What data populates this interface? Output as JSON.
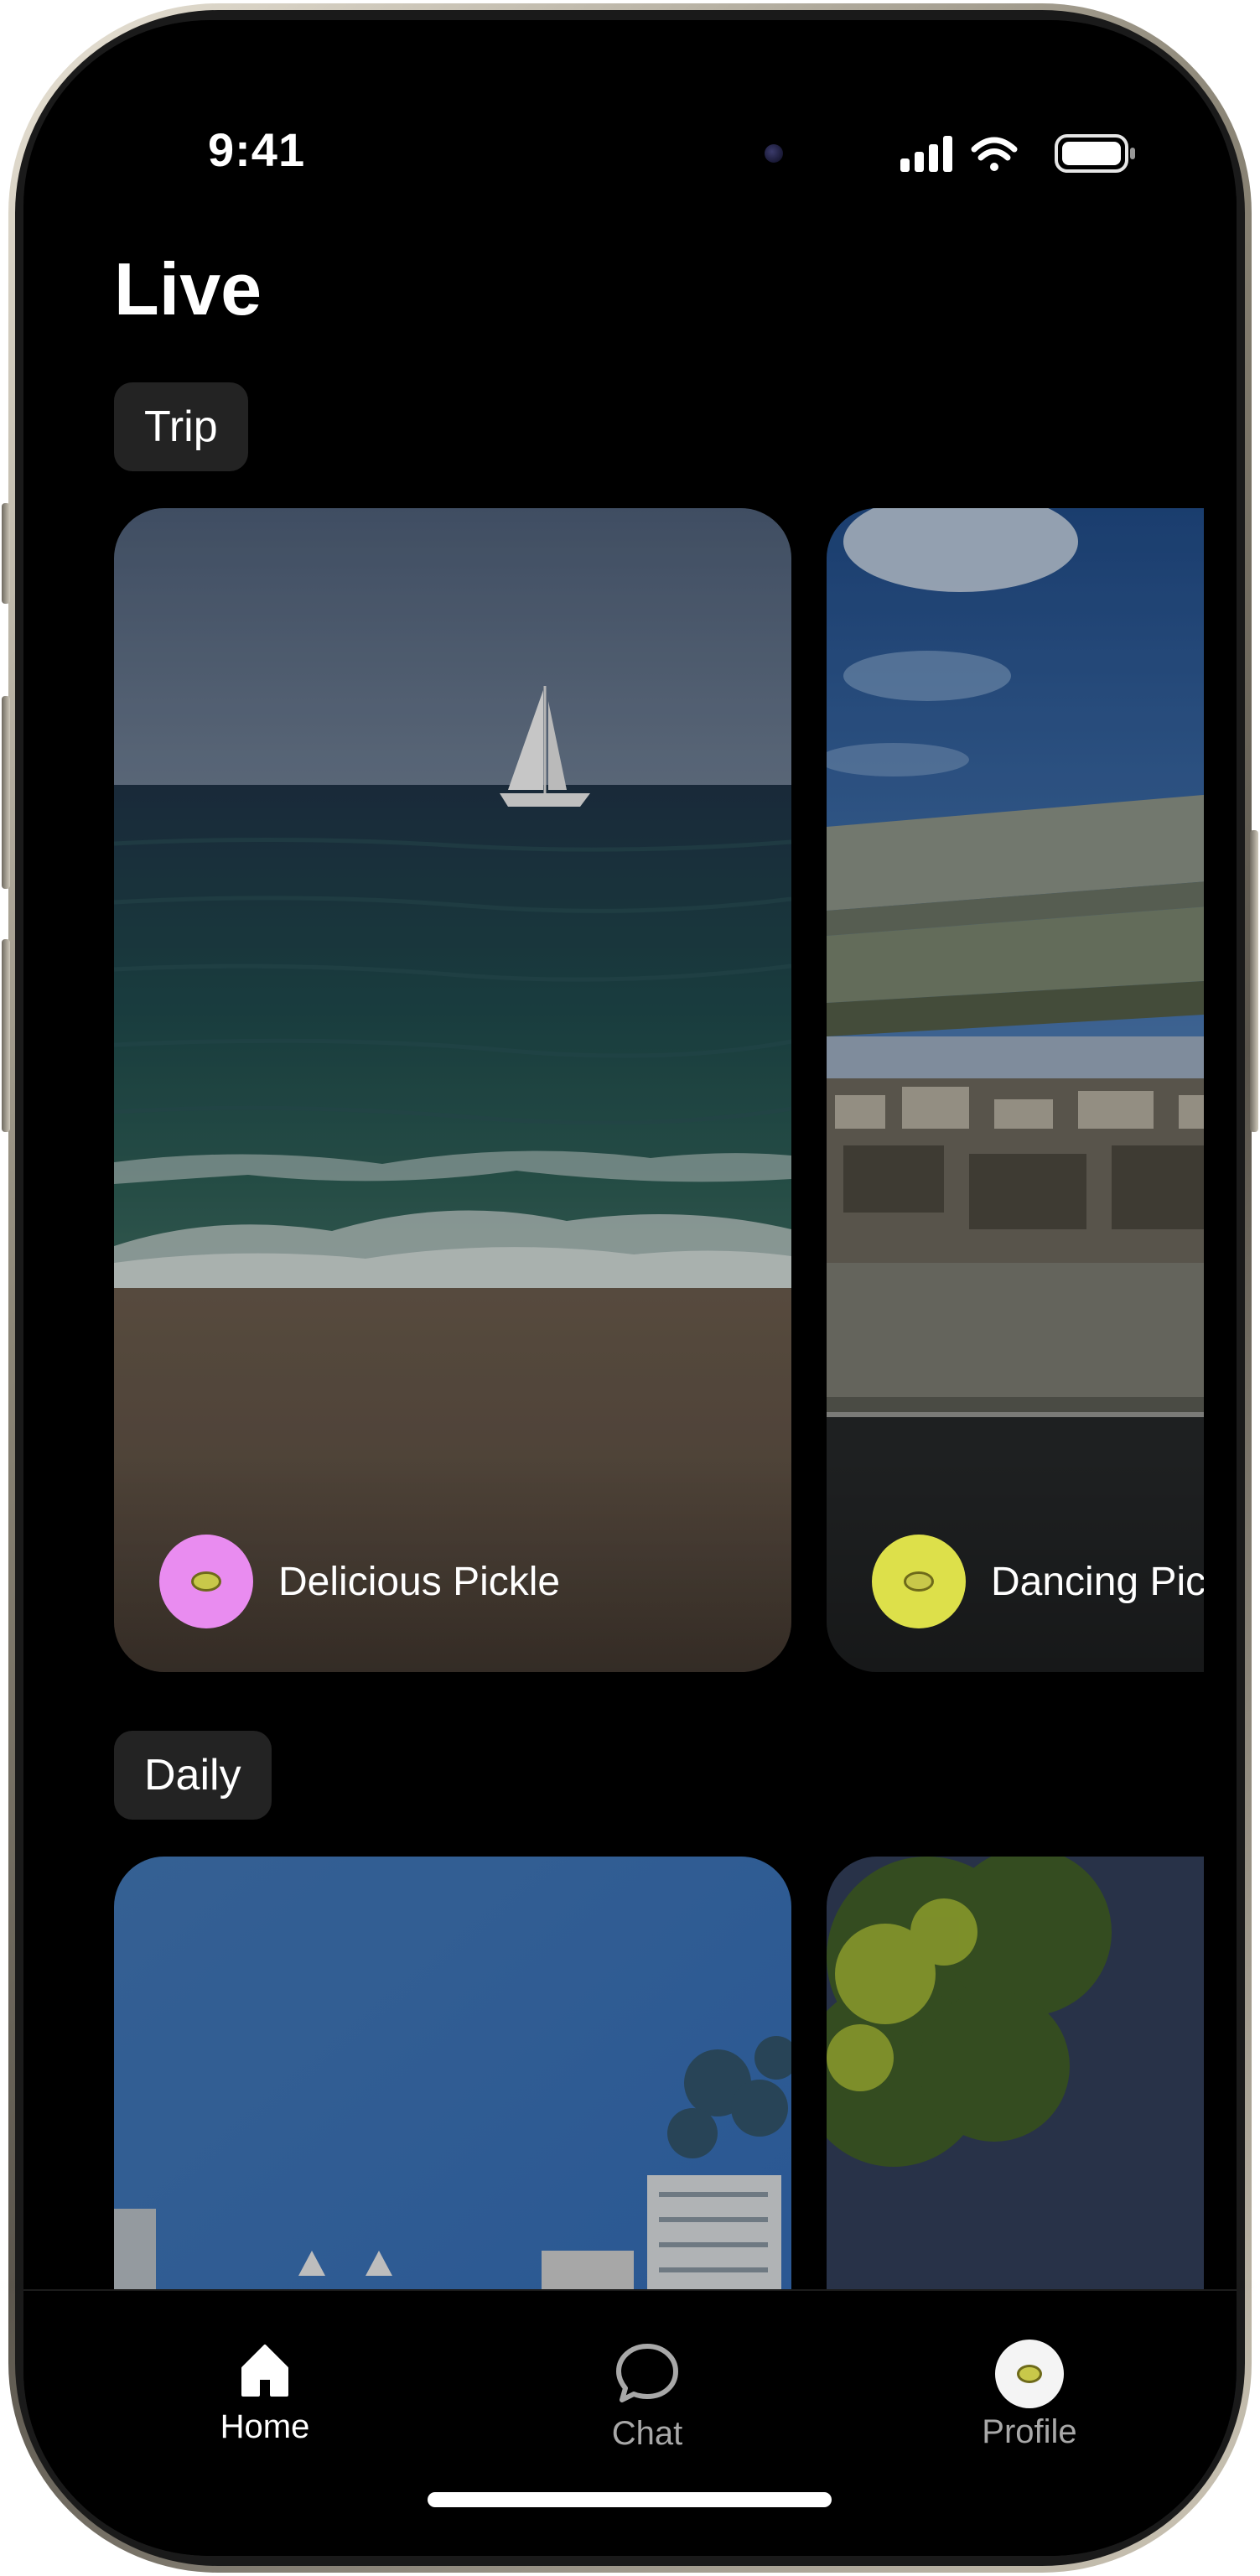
{
  "status_bar": {
    "time": "9:41",
    "icons": [
      "cellular-signal-icon",
      "wifi-icon",
      "battery-icon"
    ]
  },
  "page": {
    "title": "Live"
  },
  "sections": [
    {
      "label": "Trip",
      "cards": [
        {
          "user": "Delicious Pickle",
          "avatar_color": "#e98cf0",
          "photo": "sea-sailboat"
        },
        {
          "user": "Dancing Pic",
          "avatar_color": "#dde04a",
          "photo": "highway-overpass"
        }
      ]
    },
    {
      "label": "Daily",
      "cards": [
        {
          "photo": "city-sky"
        },
        {
          "photo": "tree-sunset"
        }
      ]
    }
  ],
  "tabbar": {
    "tabs": [
      {
        "label": "Home",
        "icon": "home-icon",
        "active": true
      },
      {
        "label": "Chat",
        "icon": "chat-bubble-icon",
        "active": false
      },
      {
        "label": "Profile",
        "icon": "profile-avatar-icon",
        "active": false
      }
    ]
  },
  "colors": {
    "background": "#000000",
    "chip": "#232323",
    "tab_active": "#ffffff",
    "tab_inactive": "#9a9a9a"
  }
}
